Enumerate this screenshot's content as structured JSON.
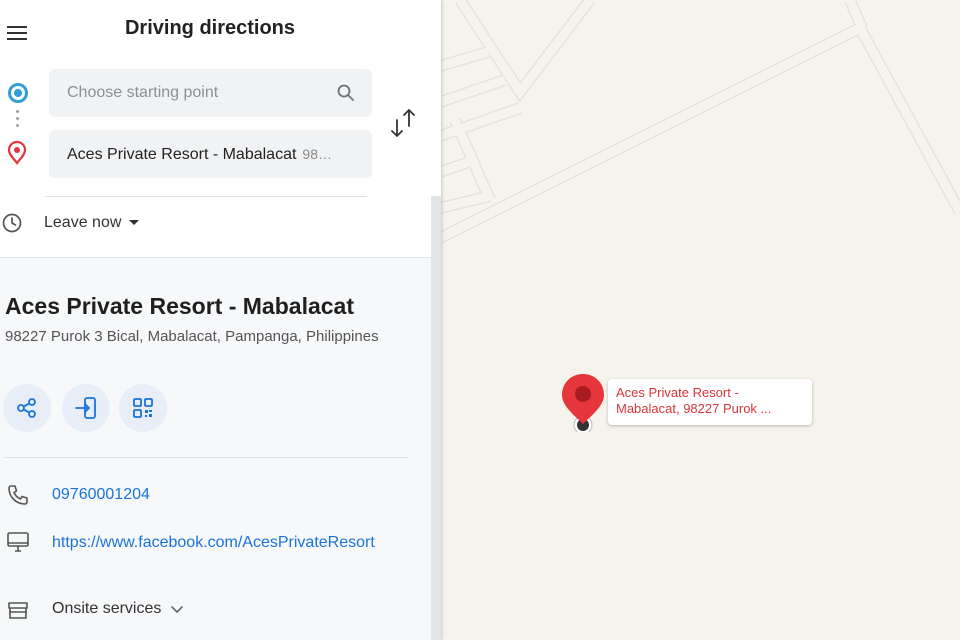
{
  "header": {
    "title": "Driving directions"
  },
  "route": {
    "origin_placeholder": "Choose starting point",
    "destination_value": "Aces Private Resort - Mabalacat",
    "destination_extra": "98…",
    "leave_label": "Leave now"
  },
  "place": {
    "name": "Aces Private Resort - Mabalacat",
    "address": "98227 Purok 3 Bical, Mabalacat, Pampanga, Philippines",
    "phone": "09760001204",
    "website": "https://www.facebook.com/AcesPrivateResort",
    "services_label": "Onsite services"
  },
  "map": {
    "marker_label_line1": "Aces Private Resort -",
    "marker_label_line2": "Mabalacat, 98227 Purok ..."
  },
  "icons": {
    "menu": "hamburger-icon",
    "origin": "origin-circle-icon",
    "destination": "location-pin-icon",
    "search": "search-icon",
    "swap": "swap-arrows-icon",
    "clock": "clock-icon",
    "share": "share-icon",
    "send": "send-to-device-icon",
    "qr": "qr-code-icon",
    "phone": "phone-icon",
    "website": "monitor-icon",
    "services": "storefront-icon",
    "chevron": "chevron-down-icon"
  },
  "colors": {
    "accent_blue": "#1a73d9",
    "marker_red": "#e5373b",
    "origin_blue": "#2f9fd6",
    "map_bg": "#f6f3ec"
  }
}
